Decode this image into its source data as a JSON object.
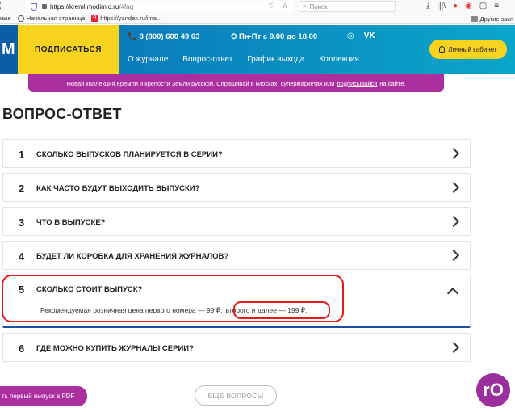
{
  "browser": {
    "back_glyph": "⟨",
    "url_host": "https://kreml.modimio.ru",
    "url_path": "/#faq",
    "page_actions": "··· ♡ ☆",
    "search_placeholder": "Поиск",
    "toolbar_icons": [
      "⤓",
      "|||\\",
      "●",
      "◉",
      "▢",
      "≡"
    ],
    "bookmarks": [
      {
        "label": "ные",
        "icon": ""
      },
      {
        "label": "Начальная страница",
        "icon": "globe-icon"
      },
      {
        "label": "https://yandex.ru/ima...",
        "icon": "yandex-icon"
      }
    ],
    "other_bookmarks": "Другие закл"
  },
  "header": {
    "logo_fragment": "М",
    "subscribe_label": "ПОДПИСАТЬСЯ",
    "phone": "📞 8 (800) 600 49 03",
    "hours": "⏲ Пн-Пт с 9.00 до 18.00",
    "social": [
      "◎",
      "VK"
    ],
    "nav": [
      "О журнале",
      "Вопрос-ответ",
      "График выхода",
      "Коллекция"
    ],
    "cabinet_label": "Личный кабинет"
  },
  "banner": {
    "text_before": "Новая коллекция Кремли и крепости Земли русской. Спрашивай в киосках, супермаркетах или",
    "link": "подписывайся",
    "text_after": "на сайте."
  },
  "page_title": "ВОПРОС-ОТВЕТ",
  "faq": [
    {
      "num": "1",
      "question": "СКОЛЬКО ВЫПУСКОВ ПЛАНИРУЕТСЯ В СЕРИИ?"
    },
    {
      "num": "2",
      "question": "КАК ЧАСТО БУДУТ ВЫХОДИТЬ ВЫПУСКИ?"
    },
    {
      "num": "3",
      "question": "ЧТО В ВЫПУСКЕ?"
    },
    {
      "num": "4",
      "question": "БУДЕТ ЛИ КОРОБКА ДЛЯ ХРАНЕНИЯ ЖУРНАЛОВ?"
    },
    {
      "num": "5",
      "question": "СКОЛЬКО СТОИТ ВЫПУСК?",
      "answer_a": "Рекомендуемая розничная цена первого номера — 99 ₽,",
      "answer_b": "второго и далее — 199 ₽."
    },
    {
      "num": "6",
      "question": "ГДЕ МОЖНО КУПИТЬ ЖУРНАЛЫ СЕРИИ?"
    }
  ],
  "footer": {
    "pdf_label": "ть первый выпуск в PDF",
    "all_questions": "ЕЩЁ ВОПРОСЫ",
    "chat_glyph": "rO"
  },
  "colors": {
    "header_gradient": [
      "#0a6fb8",
      "#0aa6c9"
    ],
    "accent_yellow": "#f7d31e",
    "accent_purple": "#ab2f9f",
    "active_underline": "#1c4fa3",
    "annotation_red": "#e81818"
  }
}
